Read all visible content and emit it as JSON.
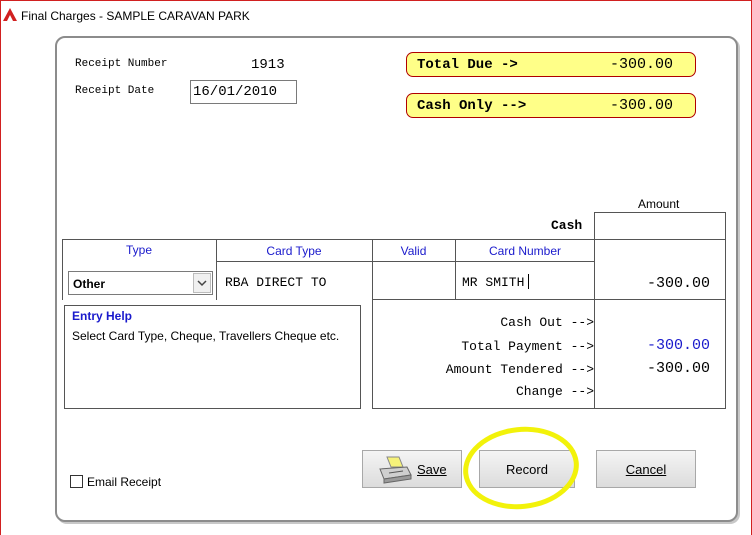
{
  "window": {
    "title": "Final Charges - SAMPLE CARAVAN  PARK"
  },
  "receipt": {
    "number_label": "Receipt Number",
    "number_value": "1913",
    "date_label": "Receipt Date",
    "date_value": "16/01/2010"
  },
  "totals": {
    "total_due_label": "Total Due  ->",
    "total_due_value": "-300.00",
    "cash_only_label": "Cash Only -->",
    "cash_only_value": "-300.00"
  },
  "payment_table": {
    "amount_header": "Amount",
    "cash_label": "Cash",
    "cash_value": "",
    "columns": [
      "Type",
      "Card Type",
      "Valid",
      "Card Number"
    ],
    "row": {
      "type": "Other",
      "card_type": "RBA DIRECT TO",
      "valid": "",
      "card_number": "MR SMITH",
      "amount": "-300.00"
    }
  },
  "entry_help": {
    "title": "Entry Help",
    "text": "Select Card Type, Cheque, Travellers Cheque etc."
  },
  "summary": {
    "cash_out_label": "Cash Out -->",
    "cash_out_value": "",
    "total_payment_label": "Total Payment -->",
    "total_payment_value": "-300.00",
    "amount_tendered_label": "Amount Tendered -->",
    "amount_tendered_value": "-300.00",
    "change_label": "Change -->",
    "change_value": "",
    "total_payment_color": "#1a1acc"
  },
  "buttons": {
    "save": "Save",
    "record": "Record",
    "cancel": "Cancel"
  },
  "email_receipt": {
    "label": "Email Receipt",
    "checked": false
  },
  "colors": {
    "frame": "#d12020",
    "pill_fill": "#ffff88",
    "pill_border": "#b00000",
    "header_blue": "#1a1acc",
    "highlight": "#f2f20a"
  }
}
